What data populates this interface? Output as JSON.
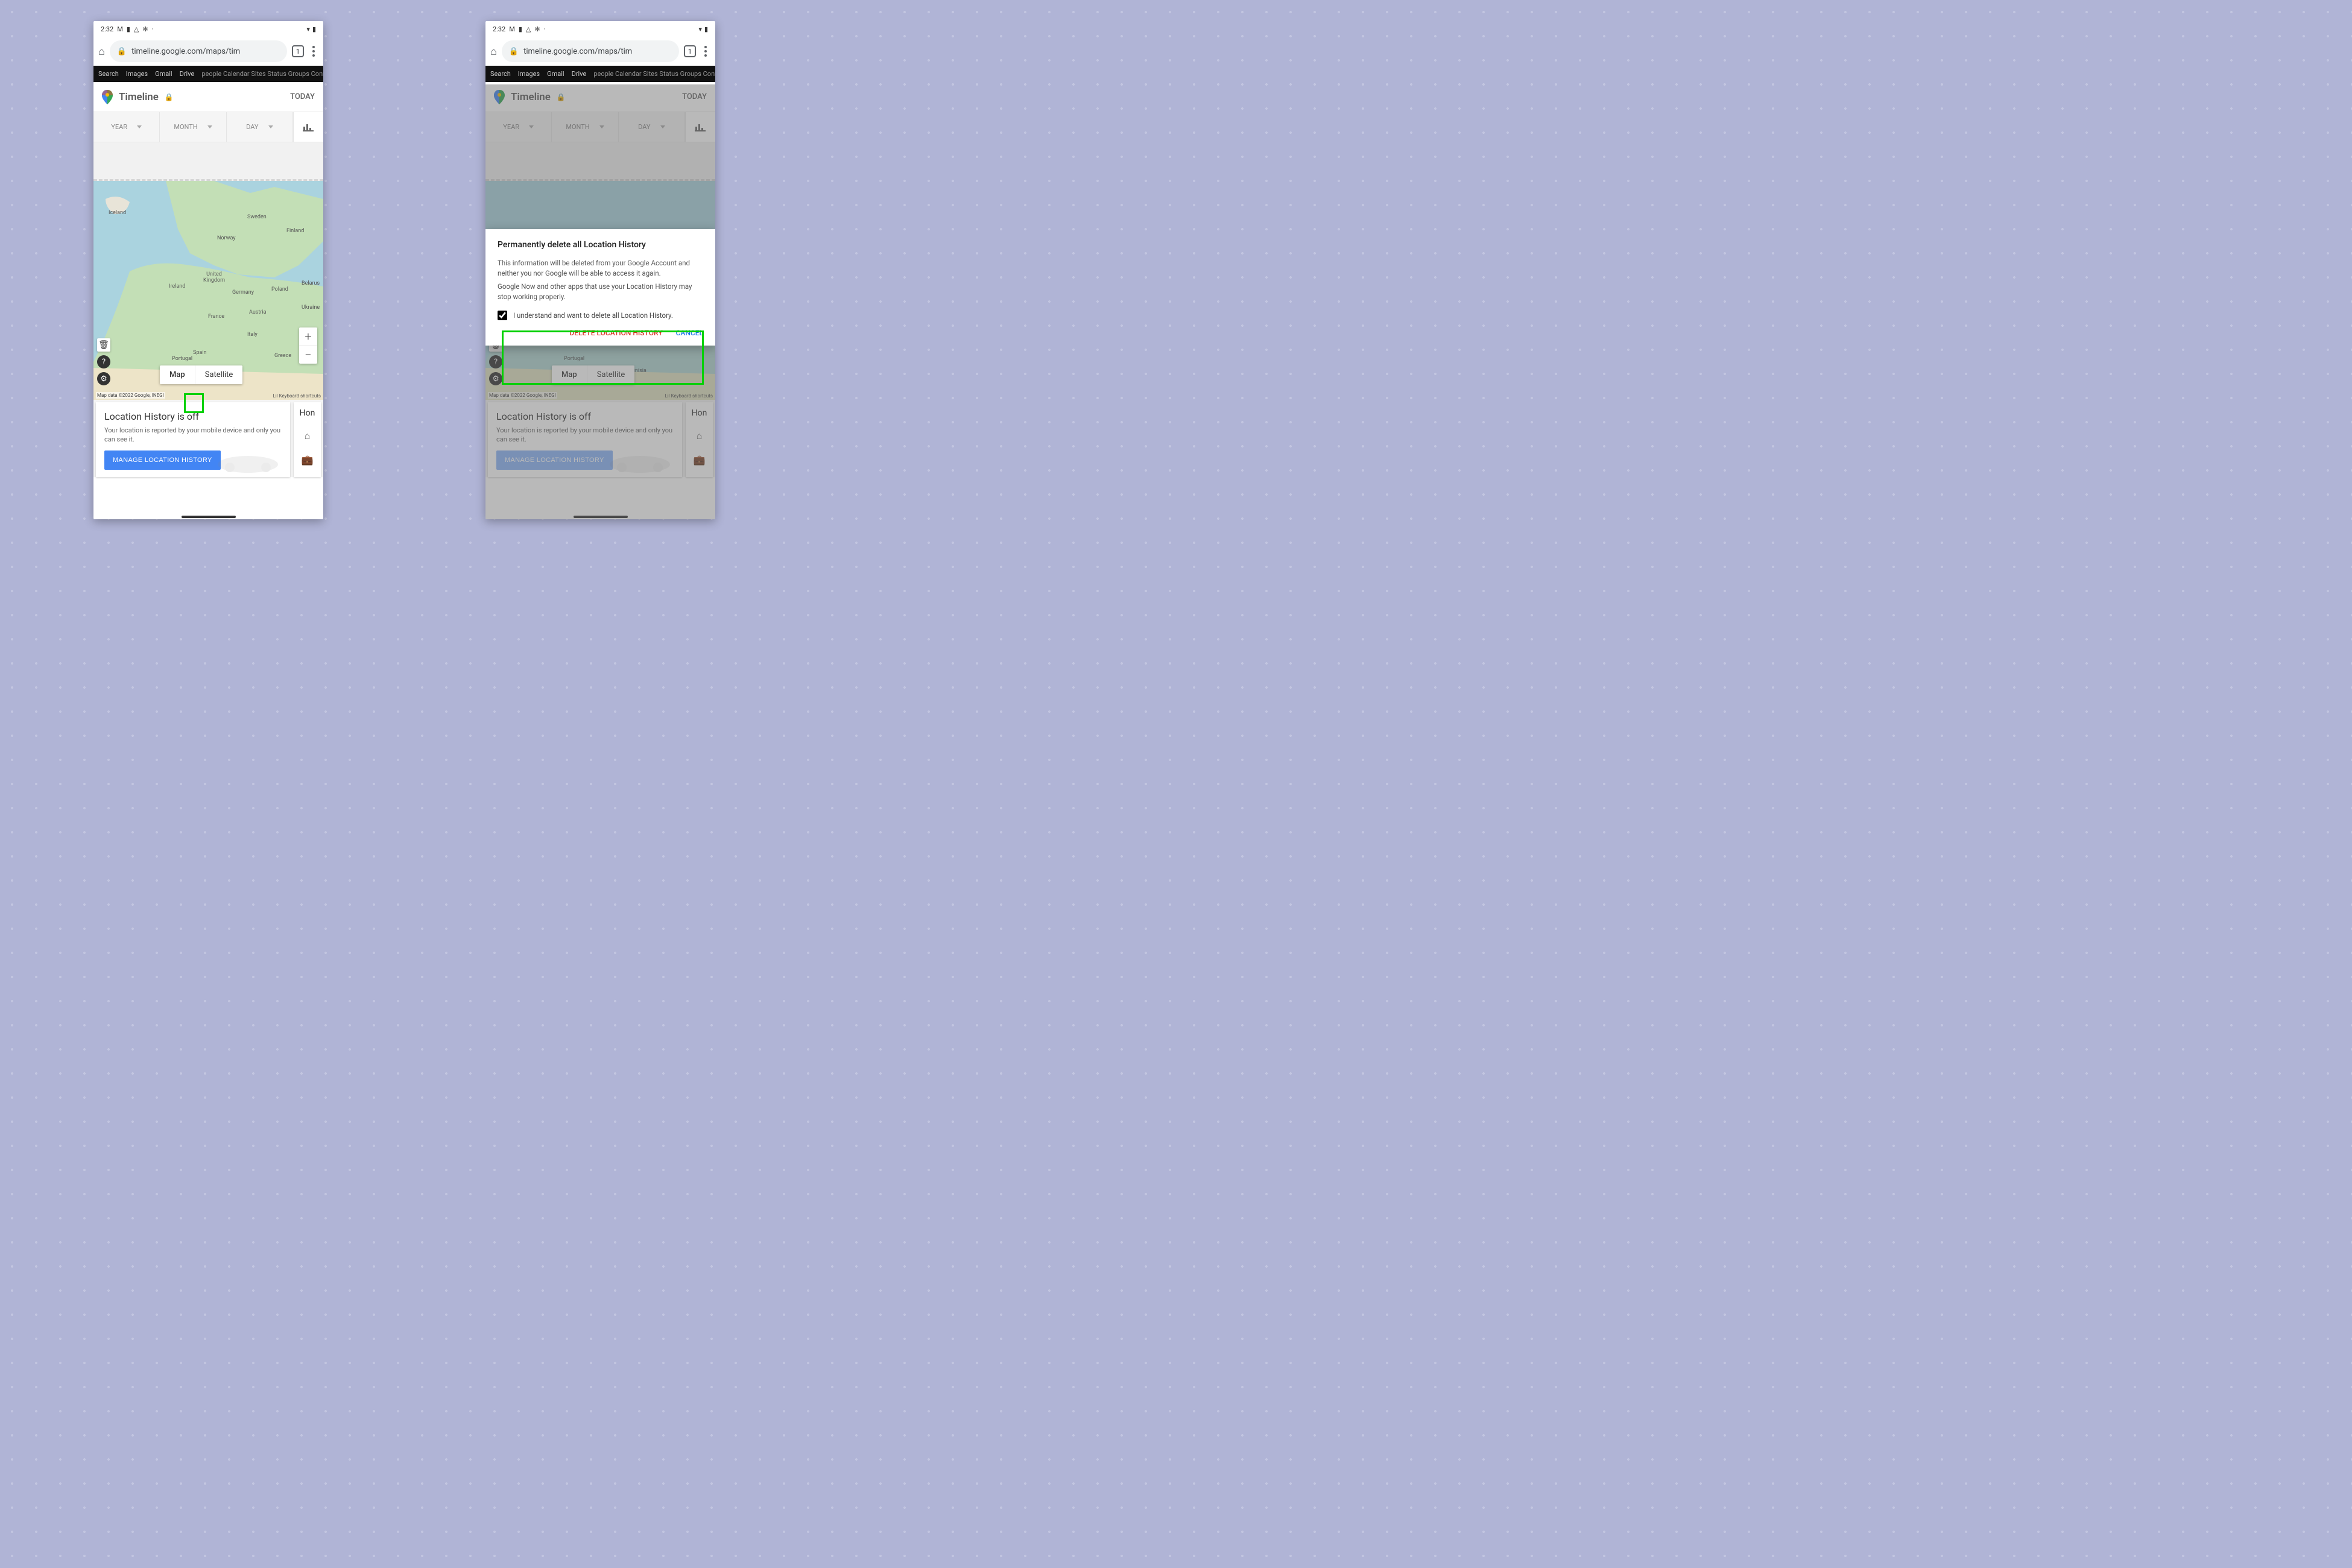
{
  "status": {
    "time": "2:32"
  },
  "url": "timeline.google.com/maps/tim",
  "tabcount": "1",
  "navlinks": [
    "Search",
    "Images",
    "Gmail",
    "Drive"
  ],
  "navextra": "people Calendar Sites Status Groups Contacts",
  "timeline": {
    "title": "Timeline",
    "today": "TODAY"
  },
  "selectors": {
    "year": "YEAR",
    "month": "MONTH",
    "day": "DAY"
  },
  "maptypes": {
    "map": "Map",
    "sat": "Satellite"
  },
  "attrib": "Map data ©2022 Google, INEGI",
  "kbd_prefix": "Lil",
  "kbd": "Keyboard shortcuts",
  "labels": {
    "iceland": "Iceland",
    "norway": "Norway",
    "sweden": "Sweden",
    "finland": "Finland",
    "uk": "United Kingdom",
    "ireland": "Ireland",
    "germany": "Germany",
    "poland": "Poland",
    "belarus": "Belarus",
    "ukraine": "Ukraine",
    "france": "France",
    "austria": "Austria",
    "italy": "Italy",
    "spain": "Spain",
    "portugal": "Portugal",
    "greece": "Greece",
    "tunisia": "Tunisia"
  },
  "footcard": {
    "title": "Location History is off",
    "desc": "Your location is reported by your mobile device and only you can see it.",
    "btn": "MANAGE LOCATION HISTORY"
  },
  "sidecard": {
    "top": "Hon"
  },
  "dialog": {
    "title": "Permanently delete all Location History",
    "p1": "This information will be deleted from your Google Account and neither you nor Google will be able to access it again.",
    "p2": "Google Now and other apps that use your Location History may stop working properly.",
    "chk": "I understand and want to delete all Location History.",
    "del": "DELETE LOCATION HISTORY",
    "cancel": "CANCEL"
  }
}
